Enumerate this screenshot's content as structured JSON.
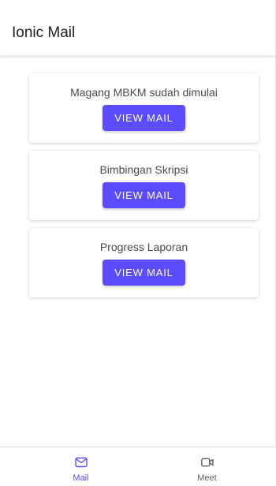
{
  "app": {
    "title": "Ionic Mail"
  },
  "mails": [
    {
      "title": "Magang MBKM sudah dimulai",
      "action_label": "VIEW MAIL"
    },
    {
      "title": "Bimbingan Skripsi",
      "action_label": "VIEW MAIL"
    },
    {
      "title": "Progress Laporan",
      "action_label": "VIEW MAIL"
    }
  ],
  "tabs": [
    {
      "label": "Mail",
      "icon": "mail-icon",
      "selected": true
    },
    {
      "label": "Meet",
      "icon": "video-camera-icon",
      "selected": false
    }
  ],
  "colors": {
    "accent": "#5b4cff",
    "inactive": "#5f5f5f"
  }
}
